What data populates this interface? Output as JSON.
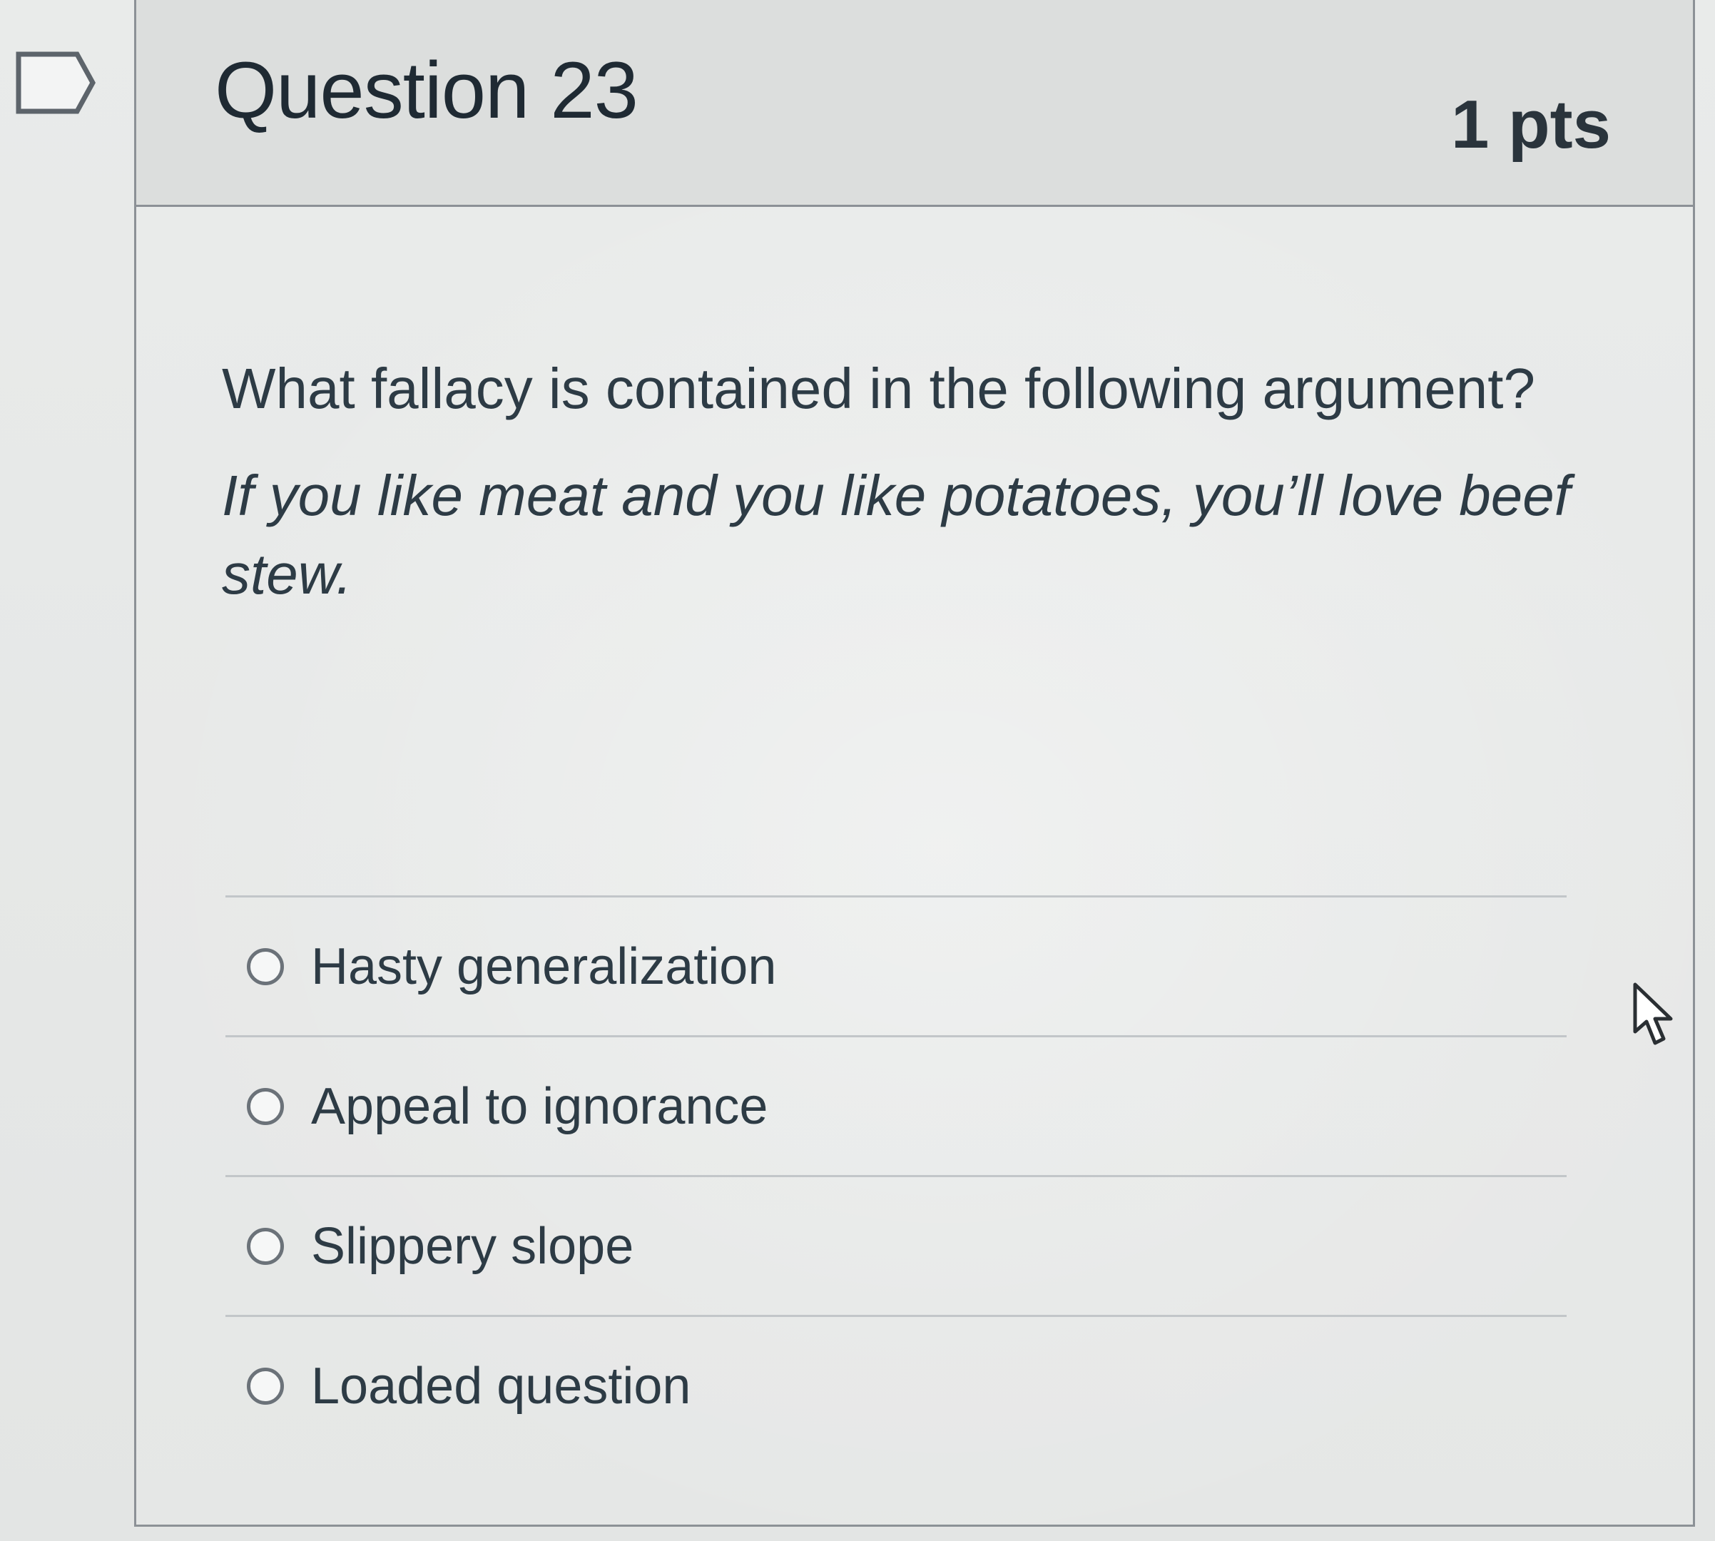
{
  "question": {
    "title": "Question 23",
    "points": "1 pts",
    "prompt": "What fallacy is contained in the following argument?",
    "argument": "If you like meat and you like potatoes, you’ll love beef stew."
  },
  "answers": [
    {
      "label": "Hasty generalization",
      "selected": false
    },
    {
      "label": "Appeal to ignorance",
      "selected": false
    },
    {
      "label": "Slippery slope",
      "selected": false
    },
    {
      "label": "Loaded question",
      "selected": false
    }
  ],
  "icons": {
    "flag": "bookmark-flag-icon",
    "radio": "radio-button-icon",
    "cursor": "mouse-pointer-icon"
  },
  "colors": {
    "text": "#2d3b45",
    "border": "#8c9196",
    "header_bg": "#dcdedd"
  }
}
